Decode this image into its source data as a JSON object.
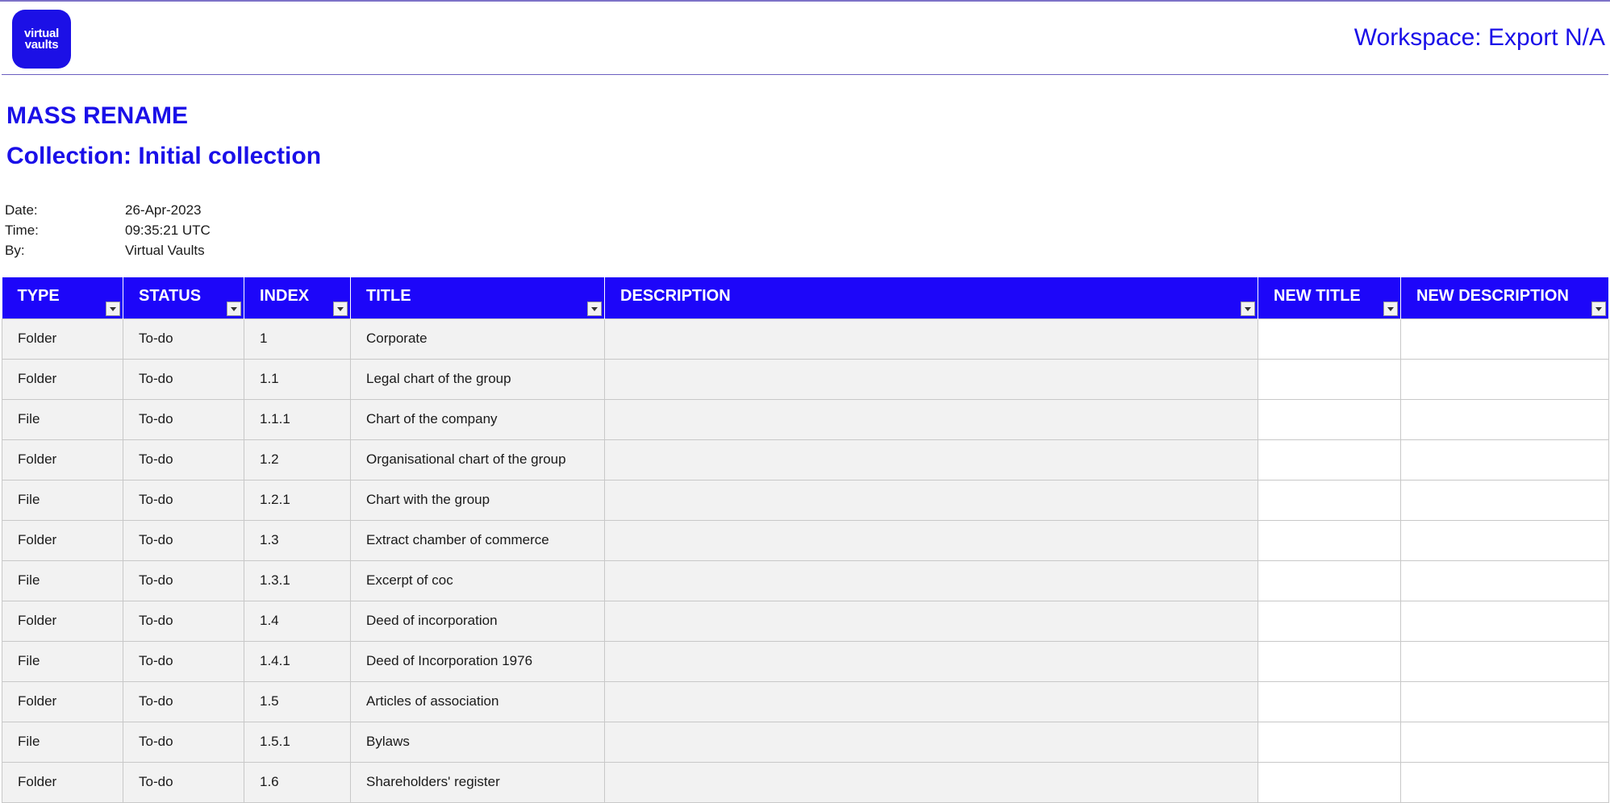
{
  "logo": {
    "line1": "virtual",
    "line2": "vaults"
  },
  "workspace_label": "Workspace: Export N/A",
  "page_title": "MASS RENAME",
  "collection_title": "Collection: Initial collection",
  "meta": [
    {
      "label": "Date:",
      "value": "26-Apr-2023"
    },
    {
      "label": "Time:",
      "value": "09:35:21 UTC"
    },
    {
      "label": "By:",
      "value": "Virtual Vaults"
    }
  ],
  "colors": {
    "accent": "#1d06f9",
    "title": "#1a0fe8",
    "row_bg": "#f2f2f2"
  },
  "table": {
    "columns": [
      "TYPE",
      "STATUS",
      "INDEX",
      "TITLE",
      "DESCRIPTION",
      "NEW TITLE",
      "NEW DESCRIPTION"
    ],
    "rows": [
      {
        "type": "Folder",
        "status": "To-do",
        "index": "1",
        "title": "Corporate",
        "description": "",
        "new_title": "",
        "new_description": ""
      },
      {
        "type": "Folder",
        "status": "To-do",
        "index": "1.1",
        "title": "Legal chart of the group",
        "description": "",
        "new_title": "",
        "new_description": ""
      },
      {
        "type": "File",
        "status": "To-do",
        "index": "1.1.1",
        "title": "Chart of the company",
        "description": "",
        "new_title": "",
        "new_description": ""
      },
      {
        "type": "Folder",
        "status": "To-do",
        "index": "1.2",
        "title": "Organisational chart of the group",
        "description": "",
        "new_title": "",
        "new_description": ""
      },
      {
        "type": "File",
        "status": "To-do",
        "index": "1.2.1",
        "title": "Chart with the group",
        "description": "",
        "new_title": "",
        "new_description": ""
      },
      {
        "type": "Folder",
        "status": "To-do",
        "index": "1.3",
        "title": "Extract chamber of commerce",
        "description": "",
        "new_title": "",
        "new_description": ""
      },
      {
        "type": "File",
        "status": "To-do",
        "index": "1.3.1",
        "title": "Excerpt of coc",
        "description": "",
        "new_title": "",
        "new_description": ""
      },
      {
        "type": "Folder",
        "status": "To-do",
        "index": "1.4",
        "title": "Deed of incorporation",
        "description": "",
        "new_title": "",
        "new_description": ""
      },
      {
        "type": "File",
        "status": "To-do",
        "index": "1.4.1",
        "title": "Deed of Incorporation 1976",
        "description": "",
        "new_title": "",
        "new_description": ""
      },
      {
        "type": "Folder",
        "status": "To-do",
        "index": "1.5",
        "title": "Articles of association",
        "description": "",
        "new_title": "",
        "new_description": ""
      },
      {
        "type": "File",
        "status": "To-do",
        "index": "1.5.1",
        "title": "Bylaws",
        "description": "",
        "new_title": "",
        "new_description": ""
      },
      {
        "type": "Folder",
        "status": "To-do",
        "index": "1.6",
        "title": "Shareholders' register",
        "description": "",
        "new_title": "",
        "new_description": ""
      }
    ]
  }
}
